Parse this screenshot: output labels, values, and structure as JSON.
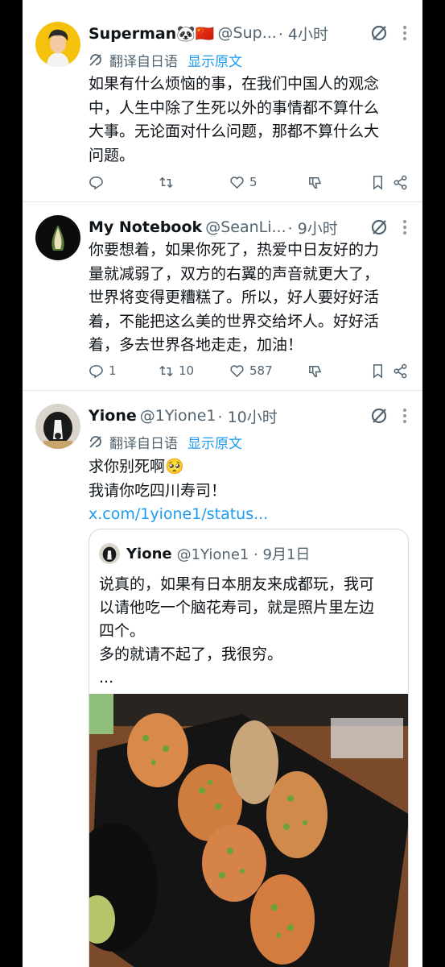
{
  "tweets": [
    {
      "name": "Superman🐼🇨🇳",
      "handle": "@Sup...",
      "time": "· 4小时",
      "translate_label": "翻译自日语",
      "show_original": "显示原文",
      "text": [
        "如果有什么烦恼的事，在我们中国人的观念",
        "中，人生中除了生死以外的事情都不算什么",
        "大事。无论面对什么问题，那都不算什么大",
        "问题。"
      ],
      "replies": "",
      "retweets": "",
      "likes": "5"
    },
    {
      "name": "My Notebook",
      "handle": "@SeanLi...",
      "time": "· 9小时",
      "text": [
        "你要想着，如果你死了，热爱中日友好的力",
        "量就减弱了，双方的右翼的声音就更大了，",
        "世界将变得更糟糕了。所以，好人要好好活",
        "着，不能把这么美的世界交给坏人。好好活",
        "着，多去世界各地走走，加油！"
      ],
      "replies": "1",
      "retweets": "10",
      "likes": "587"
    },
    {
      "name": "Yione",
      "handle": "@1Yione1",
      "time": "· 10小时",
      "translate_label": "翻译自日语",
      "show_original": "显示原文",
      "text": [
        "求你别死啊🥺",
        "我请你吃四川寿司！"
      ],
      "link": "x.com/1yione1/status...",
      "quote": {
        "name": "Yione",
        "handle": "@1Yione1 · 9月1日",
        "text": [
          "说真的，如果有日本朋友来成都玩，我可",
          "以请他吃一个脑花寿司，就是照片里左边",
          "四个。",
          "多的就请不起了，我很穷。",
          "..."
        ]
      }
    }
  ],
  "colors": {
    "accent": "#1d9bf0",
    "secondary": "#536471",
    "text": "#0f1419",
    "divider": "#e6e6e6"
  },
  "icons": [
    "grok-icon",
    "more-icon",
    "translate-icon",
    "reply-icon",
    "retweet-icon",
    "like-icon",
    "dislike-icon",
    "bookmark-icon",
    "share-icon"
  ]
}
